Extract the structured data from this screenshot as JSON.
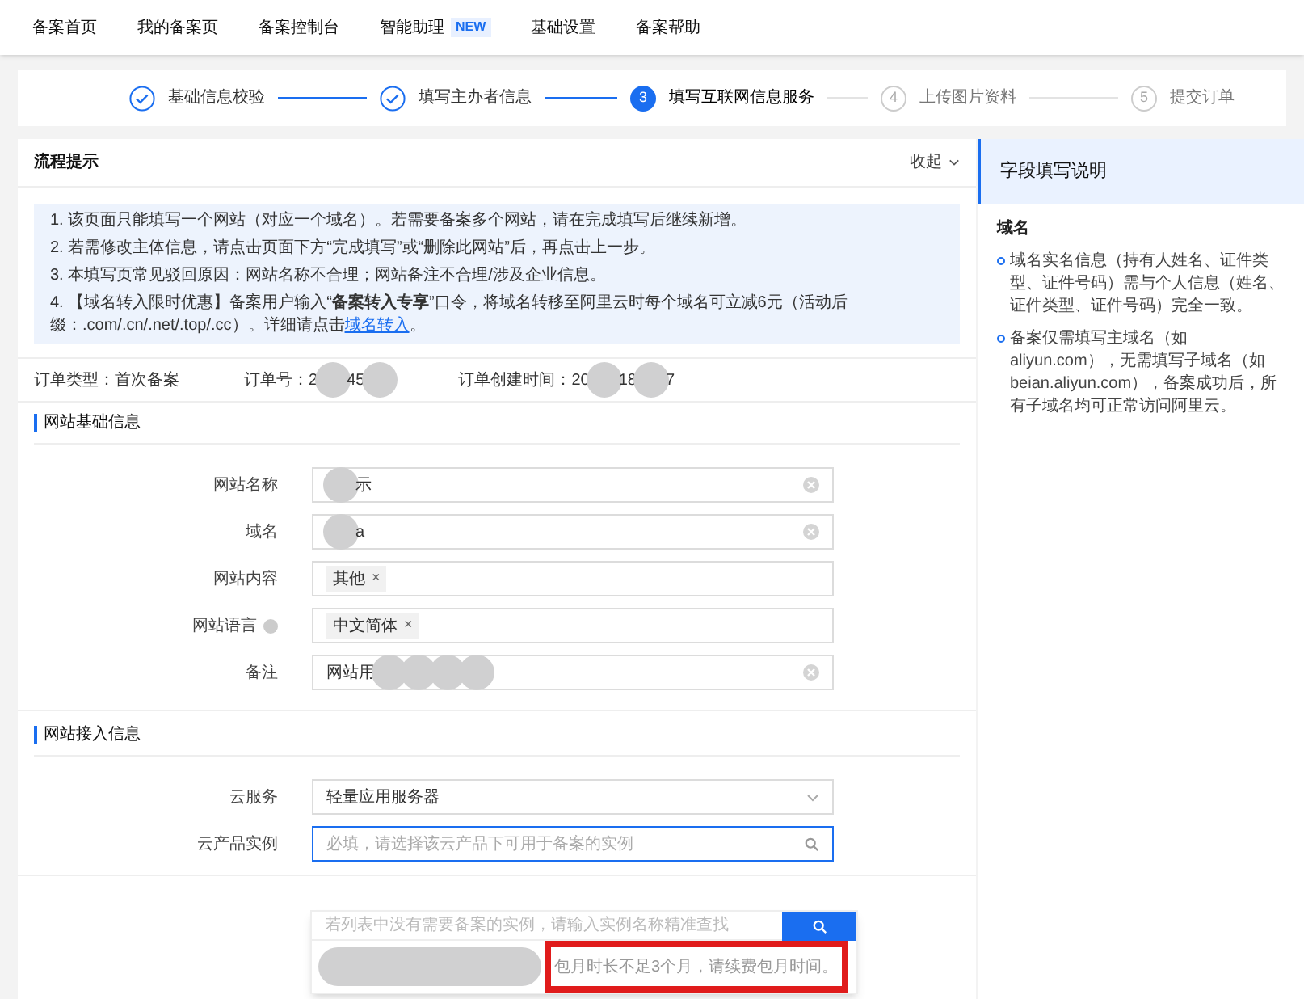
{
  "nav": {
    "items": [
      {
        "label": "备案首页"
      },
      {
        "label": "我的备案页"
      },
      {
        "label": "备案控制台"
      },
      {
        "label": "智能助理",
        "badge": "NEW"
      },
      {
        "label": "基础设置"
      },
      {
        "label": "备案帮助"
      }
    ]
  },
  "steps": [
    {
      "done": true,
      "selected": false,
      "label": "基础信息校验"
    },
    {
      "done": true,
      "selected": false,
      "label": "填写主办者信息"
    },
    {
      "done": false,
      "selected": true,
      "number": "3",
      "label": "填写互联网信息服务"
    },
    {
      "done": false,
      "selected": false,
      "number": "4",
      "label": "上传图片资料"
    },
    {
      "done": false,
      "selected": false,
      "number": "5",
      "label": "提交订单"
    }
  ],
  "tips": {
    "title": "流程提示",
    "toggle": "收起",
    "lines": [
      "1. 该页面只能填写一个网站（对应一个域名）。若需要备案多个网站，请在完成填写后继续新增。",
      "2. 若需修改主体信息，请点击页面下方“完成填写”或“删除此网站”后，再点击上一步。",
      "3. 本填写页常见驳回原因：网站名称不合理；网站备注不合理/涉及企业信息。",
      "4. 【域名转入限时优惠】备案用户输入“**备案转入专享**”口令，将域名转移至阿里云时每个域名可立减6元（活动后缀：.com/.cn/.net/.top/.cc）。详细请点击"
    ],
    "link": "域名转入",
    "after_link": "。"
  },
  "order": [
    {
      "label": "订单类型：",
      "parts": [
        {
          "kind": "text",
          "text": "首次备案"
        }
      ]
    },
    {
      "label": "订单号：",
      "parts": [
        {
          "kind": "text",
          "text": "2"
        },
        {
          "kind": "redaction"
        },
        {
          "kind": "text",
          "text": "45"
        },
        {
          "kind": "redaction"
        }
      ]
    },
    {
      "label": "订单创建时间：",
      "parts": [
        {
          "kind": "text",
          "text": "20"
        },
        {
          "kind": "redaction"
        },
        {
          "kind": "text",
          "text": "18"
        },
        {
          "kind": "redaction"
        },
        {
          "kind": "text",
          "text": "7"
        }
      ]
    }
  ],
  "sections": [
    {
      "title": "网站基础信息",
      "fields": [
        {
          "label": "网站名称",
          "kind": "text",
          "parts": [
            {
              "kind": "redaction"
            },
            {
              "kind": "text",
              "text": "示"
            }
          ],
          "clear": true
        },
        {
          "label": "域名",
          "kind": "text",
          "parts": [
            {
              "kind": "redaction"
            },
            {
              "kind": "text",
              "text": "a"
            }
          ],
          "clear": true
        },
        {
          "label": "网站内容",
          "kind": "tags",
          "tags": [
            {
              "label": "其他",
              "remove": "×"
            }
          ]
        },
        {
          "label": "网站语言",
          "kind": "tags",
          "help": true,
          "tags": [
            {
              "label": "中文简体",
              "remove": "×"
            }
          ]
        },
        {
          "label": "备注",
          "kind": "text",
          "parts": [
            {
              "kind": "text",
              "text": "网站用"
            },
            {
              "kind": "redaction"
            },
            {
              "kind": "redaction"
            },
            {
              "kind": "redaction"
            },
            {
              "kind": "redaction"
            }
          ],
          "clear": true
        }
      ]
    },
    {
      "title": "网站接入信息",
      "fields": [
        {
          "label": "云服务",
          "kind": "select",
          "value": "轻量应用服务器"
        },
        {
          "label": "云产品实例",
          "kind": "search",
          "placeholder": "必填，请选择该云产品下可用于备案的实例",
          "focused": true
        }
      ]
    }
  ],
  "popover": {
    "placeholder": "若列表中没有需要备案的实例，请输入实例名称精准查找",
    "option_parts": [
      {
        "kind": "redaction"
      },
      {
        "kind": "text",
        "text": "包月时长不足3个月，请续费包月时间。"
      }
    ]
  },
  "help_panel": {
    "title": "字段填写说明",
    "field": "域名",
    "notes": [
      "域名实名信息（持有人姓名、证件类型、证件号码）需与个人信息（姓名、证件类型、证件号码）完全一致。",
      "备案仅需填写主域名（如aliyun.com），无需填写子域名（如beian.aliyun.com），备案成功后，所有子域名均可正常访问阿里云。"
    ]
  }
}
